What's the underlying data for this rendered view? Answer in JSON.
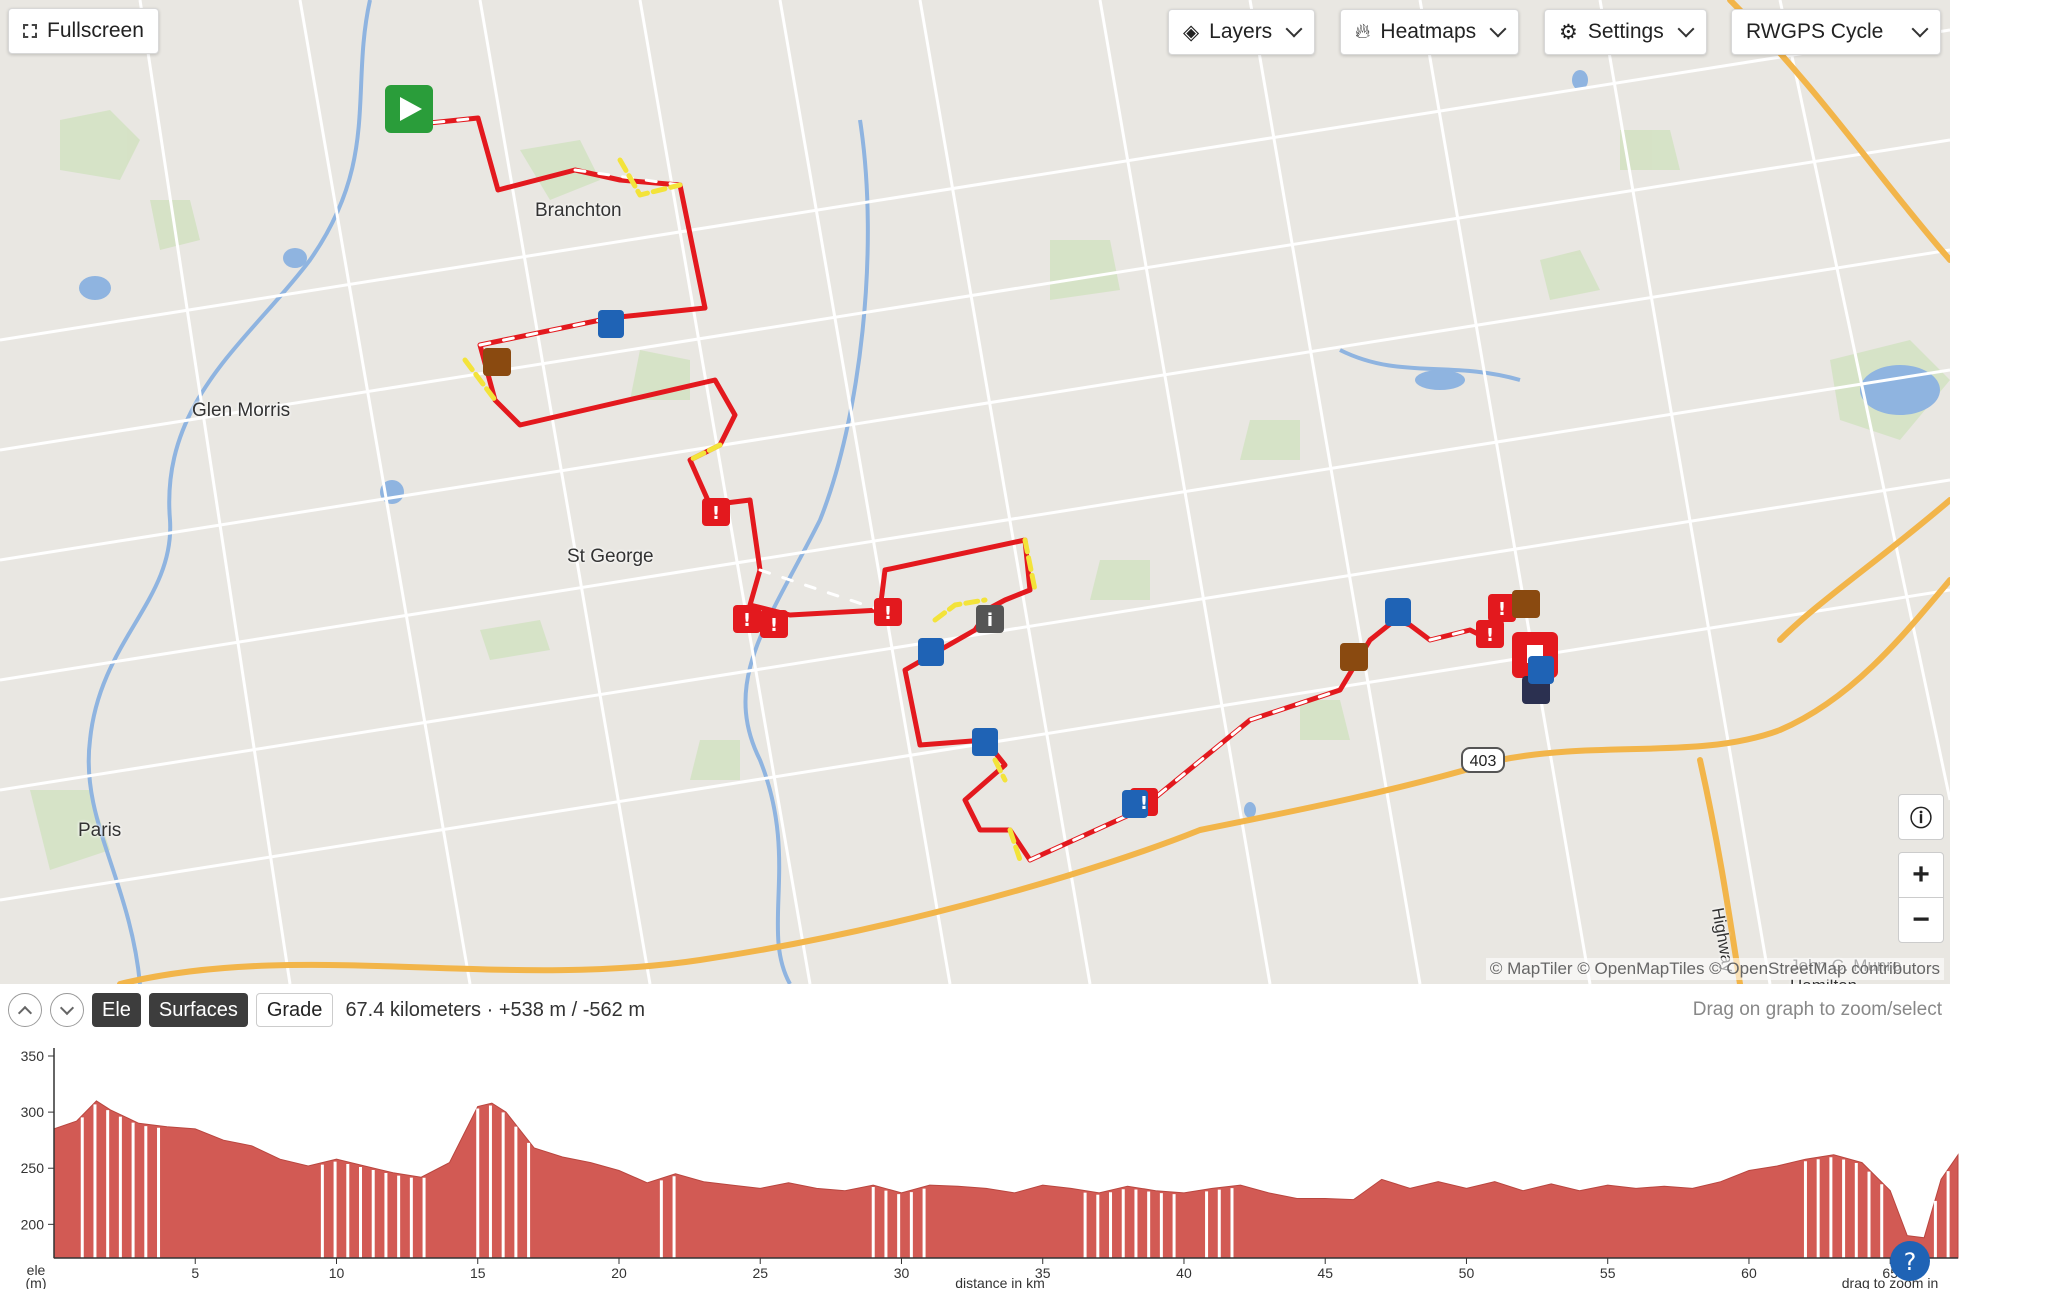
{
  "controls": {
    "fullscreen_label": "Fullscreen",
    "layers_label": "Layers",
    "heatmaps_label": "Heatmaps",
    "settings_label": "Settings",
    "map_style_label": "RWGPS Cycle"
  },
  "map": {
    "places": [
      "Branchton",
      "Glen Morris",
      "St George",
      "Paris",
      "John C. Munro Hamilton"
    ],
    "highway_shield": "403",
    "road_label": "Highway",
    "attribution": "© MapTiler © OpenMapTiles © OpenStreetMap contributors",
    "route_color": "#e3191e",
    "unpaved_color": "#f3e33a",
    "road_color": "#f2b54a"
  },
  "profile": {
    "tabs": [
      "Ele",
      "Surfaces",
      "Grade"
    ],
    "summary": "67.4 kilometers · +538 m / -562 m",
    "hint": "Drag on graph to zoom/select",
    "y_axis_label": "ele\n(m)",
    "x_axis_label": "distance in km",
    "x_hint": "drag to zoom in",
    "fill_color": "#d25a54"
  },
  "chart_data": {
    "type": "area",
    "xlabel": "distance in km",
    "ylabel": "ele (m)",
    "ylim": [
      170,
      350
    ],
    "xlim": [
      0,
      67.4
    ],
    "yticks": [
      200,
      250,
      300,
      350
    ],
    "xticks": [
      5,
      10,
      15,
      20,
      25,
      30,
      35,
      40,
      45,
      50,
      55,
      60,
      65
    ],
    "x": [
      0,
      0.8,
      1.5,
      2,
      3,
      4,
      5,
      6,
      7,
      8,
      9,
      10,
      11,
      12,
      13,
      14,
      14.5,
      15,
      15.5,
      16,
      17,
      18,
      19,
      20,
      21,
      22,
      23,
      24,
      25,
      26,
      27,
      28,
      29,
      30,
      31,
      32,
      33,
      34,
      35,
      36,
      37,
      38,
      39,
      40,
      41,
      42,
      43,
      44,
      45,
      46,
      47,
      48,
      49,
      50,
      51,
      52,
      53,
      54,
      55,
      56,
      57,
      58,
      59,
      60,
      61,
      62,
      63,
      64,
      65,
      65.6,
      66.2,
      66.8,
      67.4
    ],
    "y": [
      285,
      292,
      310,
      302,
      290,
      287,
      285,
      275,
      270,
      258,
      252,
      258,
      252,
      246,
      242,
      255,
      280,
      305,
      308,
      300,
      268,
      260,
      255,
      248,
      237,
      245,
      238,
      235,
      232,
      237,
      232,
      230,
      235,
      228,
      235,
      234,
      232,
      228,
      235,
      232,
      228,
      234,
      230,
      228,
      232,
      235,
      228,
      223,
      223,
      222,
      240,
      232,
      238,
      232,
      238,
      230,
      236,
      230,
      235,
      232,
      234,
      232,
      238,
      248,
      252,
      258,
      262,
      255,
      230,
      190,
      188,
      240,
      262
    ]
  }
}
